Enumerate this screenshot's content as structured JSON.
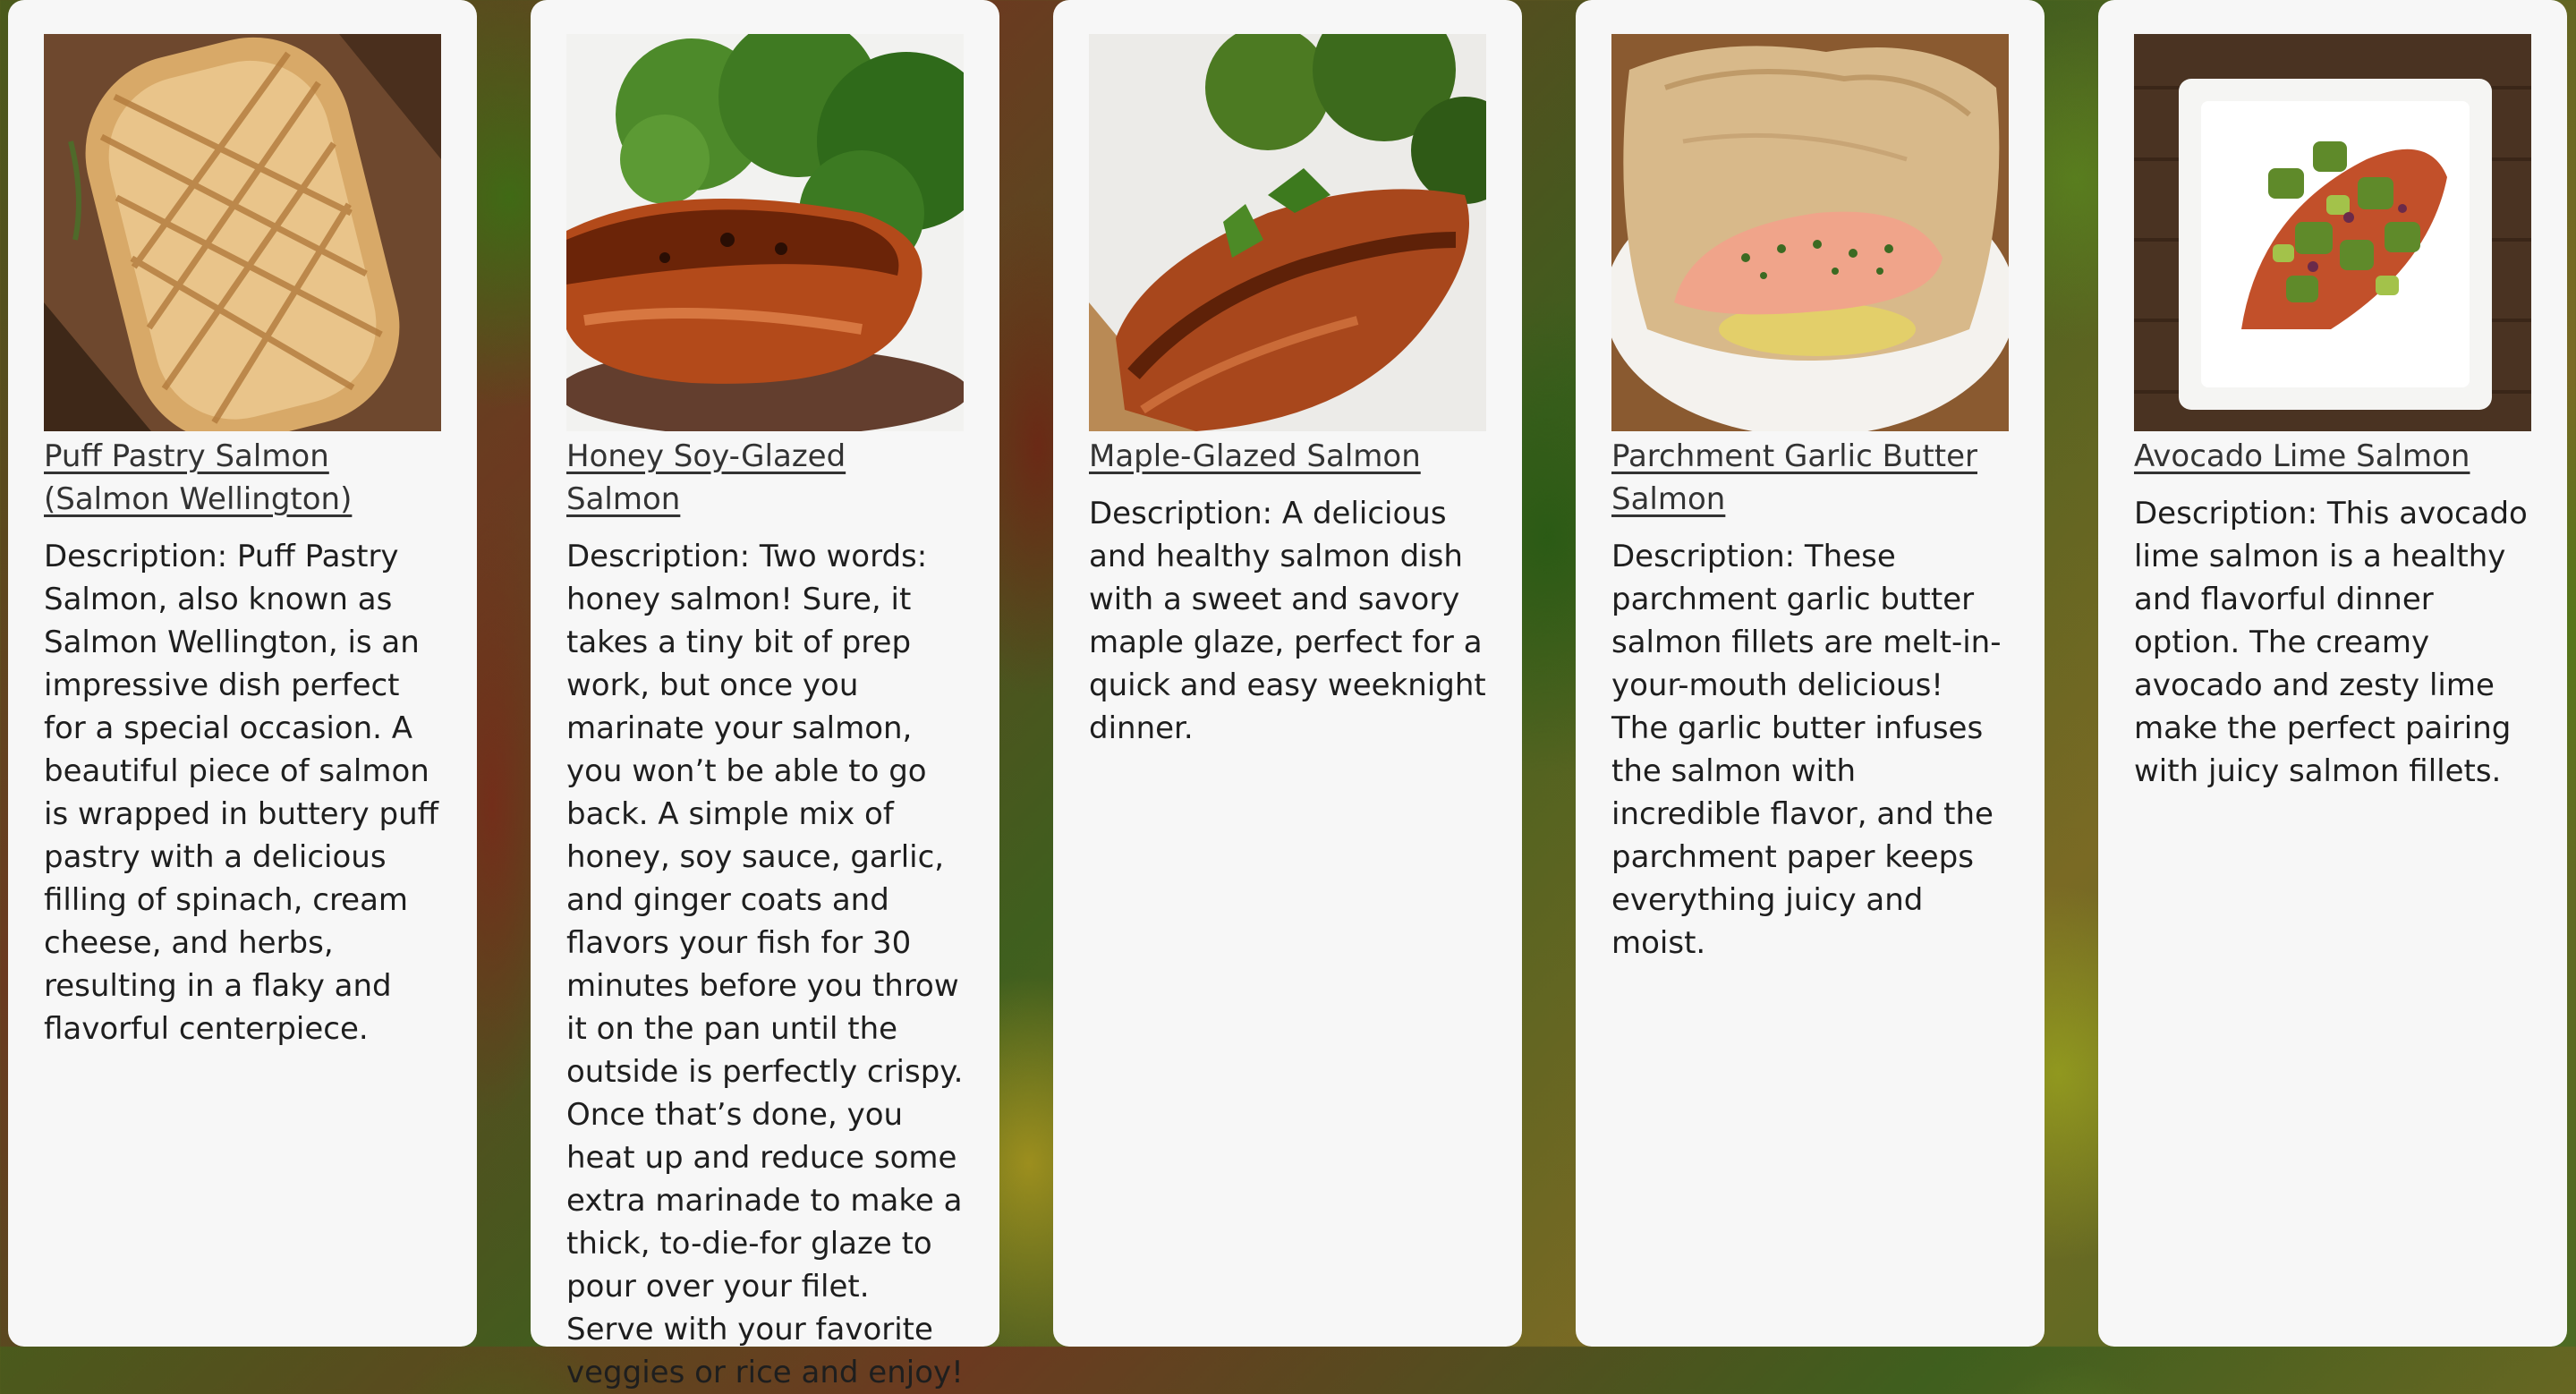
{
  "recipes": [
    {
      "title": "Puff Pastry Salmon (Salmon Wellington)",
      "description": "Description: Puff Pastry Salmon, also known as Salmon Wellington, is an impressive dish perfect for a special occasion. A beautiful piece of salmon is wrapped in buttery puff pastry with a delicious filling of spinach, cream cheese, and herbs, resulting in a flaky and flavorful centerpiece.",
      "image_icon": "salmon-wellington-photo"
    },
    {
      "title": "Honey Soy-Glazed Salmon",
      "description": "Description: Two words: honey salmon! Sure, it takes a tiny bit of prep work, but once you marinate your salmon, you won’t be able to go back. A simple mix of honey, soy sauce, garlic, and ginger coats and flavors your fish for 30 minutes before you throw it on the pan until the outside is perfectly crispy. Once that’s done, you heat up and reduce some extra marinade to make a thick, to-die-for glaze to pour over your filet. Serve with your favorite veggies or rice and enjoy!",
      "image_icon": "honey-soy-salmon-photo"
    },
    {
      "title": "Maple-Glazed Salmon",
      "description": "Description: A delicious and healthy salmon dish with a sweet and savory maple glaze, perfect for a quick and easy weeknight dinner.",
      "image_icon": "maple-glazed-salmon-photo"
    },
    {
      "title": "Parchment Garlic Butter Salmon",
      "description": "Description: These parchment garlic butter salmon fillets are melt-in-your-mouth delicious! The garlic butter infuses the salmon with incredible flavor, and the parchment paper keeps everything juicy and moist.",
      "image_icon": "parchment-salmon-photo"
    },
    {
      "title": "Avocado Lime Salmon",
      "description": "Description: This avocado lime salmon is a healthy and flavorful dinner option. The creamy avocado and zesty lime make the perfect pairing with juicy salmon fillets.",
      "image_icon": "avocado-lime-salmon-photo"
    }
  ],
  "colors": {
    "card_background": "#f7f7f7",
    "link_text": "#333333",
    "body_text": "#1e1e1e"
  }
}
